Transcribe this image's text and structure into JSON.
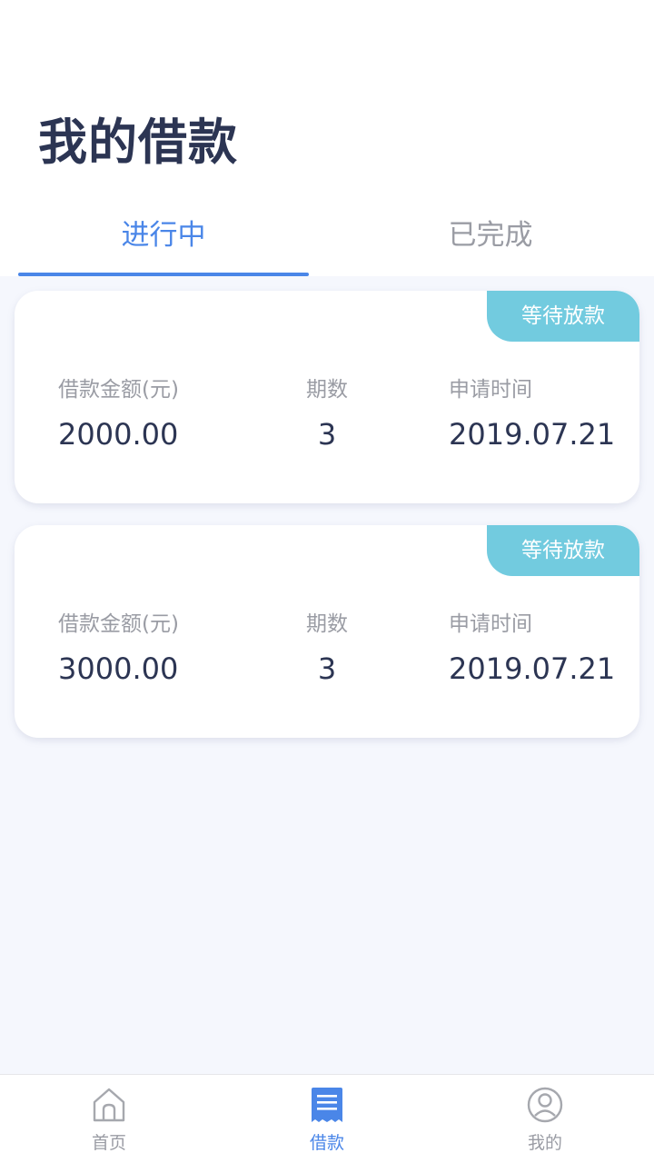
{
  "page": {
    "title": "我的借款"
  },
  "tabs": [
    {
      "label": "进行中",
      "active": true
    },
    {
      "label": "已完成",
      "active": false
    }
  ],
  "loans": [
    {
      "status": "等待放款",
      "amount_label": "借款金额(元)",
      "amount": "2000.00",
      "term_label": "期数",
      "term": "3",
      "date_label": "申请时间",
      "date": "2019.07.21"
    },
    {
      "status": "等待放款",
      "amount_label": "借款金额(元)",
      "amount": "3000.00",
      "term_label": "期数",
      "term": "3",
      "date_label": "申请时间",
      "date": "2019.07.21"
    }
  ],
  "nav": [
    {
      "label": "首页",
      "icon": "home-icon",
      "active": false
    },
    {
      "label": "借款",
      "icon": "receipt-icon",
      "active": true
    },
    {
      "label": "我的",
      "icon": "user-icon",
      "active": false
    }
  ],
  "colors": {
    "accent": "#4a86e8",
    "badge": "#72cbdf",
    "title": "#2c3553",
    "muted": "#9a9ca4",
    "background": "#f5f7fd"
  }
}
